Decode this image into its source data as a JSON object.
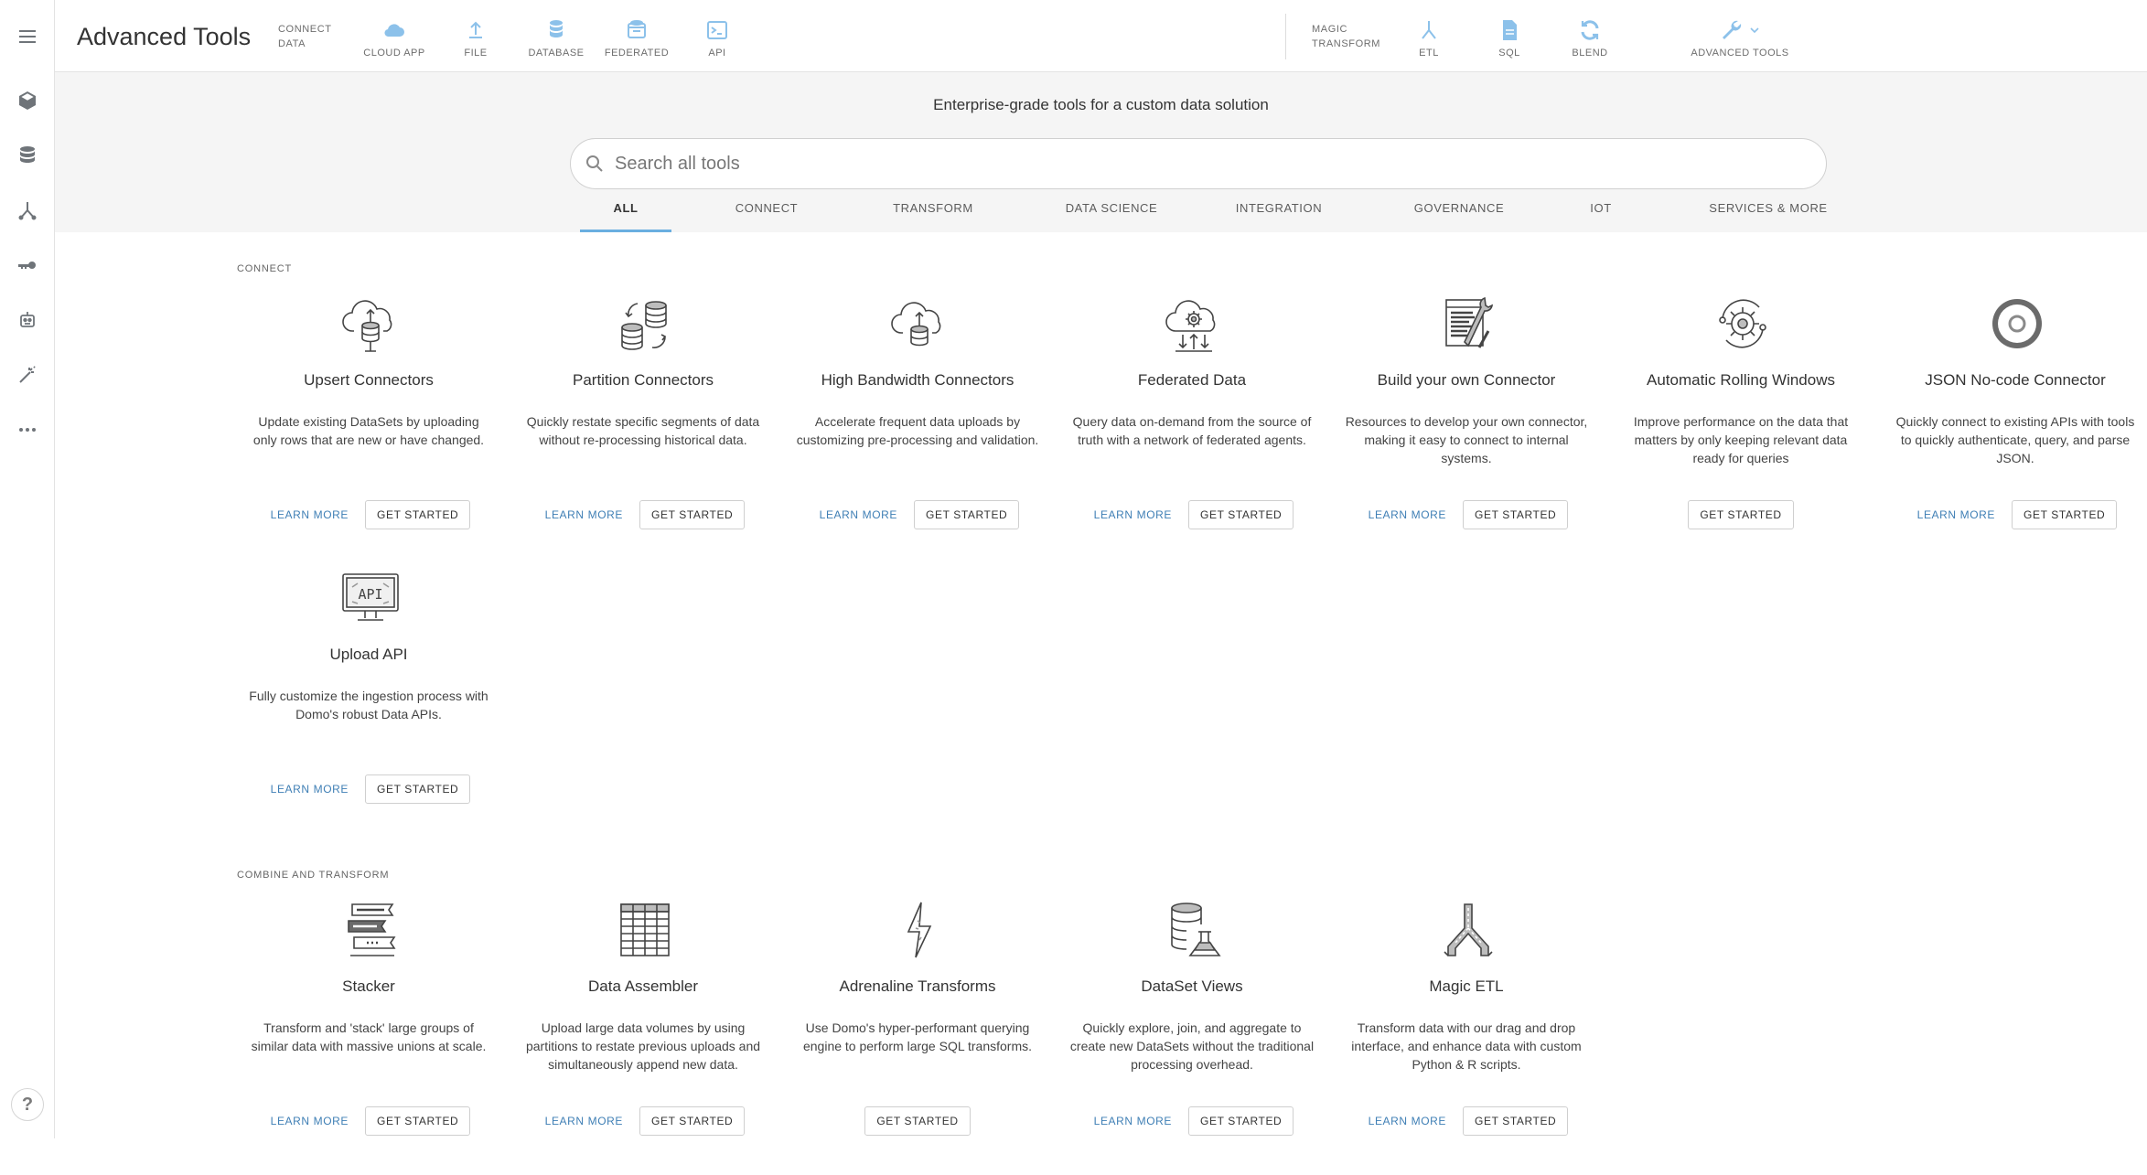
{
  "app": {
    "title": "Advanced Tools"
  },
  "topbar": {
    "connect_group_label": [
      "CONNECT",
      "DATA"
    ],
    "connect_tools": [
      {
        "label": "CLOUD APP",
        "icon": "cloud-icon"
      },
      {
        "label": "FILE",
        "icon": "upload-icon"
      },
      {
        "label": "DATABASE",
        "icon": "database-icon"
      },
      {
        "label": "FEDERATED",
        "icon": "federated-icon"
      },
      {
        "label": "API",
        "icon": "terminal-icon"
      }
    ],
    "transform_group_label": [
      "MAGIC",
      "TRANSFORM"
    ],
    "transform_tools": [
      {
        "label": "ETL",
        "icon": "etl-icon"
      },
      {
        "label": "SQL",
        "icon": "sql-file-icon"
      },
      {
        "label": "BLEND",
        "icon": "blend-icon"
      },
      {
        "label": "ADVANCED TOOLS",
        "icon": "wrench-icon"
      }
    ]
  },
  "sidebar": {
    "items": [
      "menu-icon",
      "cube-icon",
      "database-icon",
      "etl-icon",
      "key-icon",
      "robot-icon",
      "magic-wand-icon",
      "more-icon"
    ],
    "help_label": "?"
  },
  "hero": {
    "title": "Enterprise-grade tools for a custom data solution",
    "search_placeholder": "Search all tools"
  },
  "filters": [
    "ALL",
    "CONNECT",
    "TRANSFORM",
    "DATA SCIENCE",
    "INTEGRATION",
    "GOVERNANCE",
    "IOT",
    "SERVICES & MORE"
  ],
  "active_filter": "ALL",
  "colors": {
    "accent": "#6aafe0",
    "link": "#3f7fb5",
    "hero_bg": "#f5f5f5"
  },
  "sections": [
    {
      "label": "CONNECT",
      "cards": [
        {
          "title": "Upsert Connectors",
          "desc": "Update existing DataSets by uploading only rows that are new or have changed.",
          "icon": "cloud-database-icon",
          "learn": "LEARN MORE",
          "start": "GET STARTED"
        },
        {
          "title": "Partition Connectors",
          "desc": "Quickly restate specific segments of data without re-processing historical data.",
          "icon": "partition-databases-icon",
          "learn": "LEARN MORE",
          "start": "GET STARTED"
        },
        {
          "title": "High Bandwidth Connectors",
          "desc": "Accelerate frequent data uploads by customizing pre-processing and validation.",
          "icon": "cloud-upload-database-icon",
          "learn": "LEARN MORE",
          "start": "GET STARTED"
        },
        {
          "title": "Federated Data",
          "desc": "Query data on-demand from the source of truth with a network of federated agents.",
          "icon": "cloud-gear-icon",
          "learn": "LEARN MORE",
          "start": "GET STARTED"
        },
        {
          "title": "Build your own Connector",
          "desc": "Resources to develop your own connector, making it easy to connect to internal systems.",
          "icon": "document-tools-icon",
          "learn": "LEARN MORE",
          "start": "GET STARTED"
        },
        {
          "title": "Automatic Rolling Windows",
          "desc": "Improve performance on the data that matters by only keeping relevant data ready for queries",
          "icon": "rolling-gear-icon",
          "learn": "",
          "start": "GET STARTED"
        },
        {
          "title": "JSON No-code Connector",
          "desc": "Quickly connect to existing APIs with tools to quickly authenticate, query, and parse JSON.",
          "icon": "json-logo-icon",
          "learn": "LEARN MORE",
          "start": "GET STARTED"
        },
        {
          "title": "Upload API",
          "desc": "Fully customize the ingestion process with Domo's robust Data APIs.",
          "icon": "api-monitor-icon",
          "learn": "LEARN MORE",
          "start": "GET STARTED"
        }
      ]
    },
    {
      "label": "COMBINE AND TRANSFORM",
      "cards": [
        {
          "title": "Stacker",
          "desc": "Transform and 'stack' large groups of similar data with massive unions at scale.",
          "icon": "stacker-icon",
          "learn": "LEARN MORE",
          "start": "GET STARTED"
        },
        {
          "title": "Data Assembler",
          "desc": "Upload large data volumes by using partitions to restate previous uploads and simultaneously append new data.",
          "icon": "grid-table-icon",
          "learn": "LEARN MORE",
          "start": "GET STARTED"
        },
        {
          "title": "Adrenaline Transforms",
          "desc": "Use Domo's hyper-performant querying engine to perform large SQL transforms.",
          "icon": "lightning-icon",
          "learn": "",
          "start": "GET STARTED"
        },
        {
          "title": "DataSet Views",
          "desc": "Quickly explore, join, and aggregate to create new DataSets without the traditional processing overhead.",
          "icon": "database-flask-icon",
          "learn": "LEARN MORE",
          "start": "GET STARTED"
        },
        {
          "title": "Magic ETL",
          "desc": "Transform data with our drag and drop interface, and enhance data with custom Python & R scripts.",
          "icon": "magic-etl-icon",
          "learn": "LEARN MORE",
          "start": "GET STARTED"
        }
      ]
    }
  ]
}
